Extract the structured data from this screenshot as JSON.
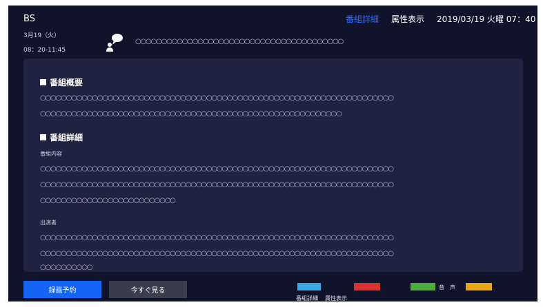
{
  "header": {
    "channel": "BS",
    "tab_detail": "番組詳細",
    "tab_attribute": "属性表示",
    "datetime": "2019/03/19 火曜 07：40"
  },
  "program": {
    "date": "3月19（火）",
    "time": "08：20-11:45",
    "title": "○○○○○○○○○○○○○○○○○○○○○○○○○○○○○○○○○○○○○○○○"
  },
  "content": {
    "summary": {
      "heading": "番組概要",
      "lines": [
        "○○○○○○○○○○○○○○○○○○○○○○○○○○○○○○○○○○○○○○○○○○○○○○○○○○○○○○○○○○○○○○○○○○○○",
        "○○○○○○○○○○○○○○○○○○○○○○○○○○○○○○○○○○○○○○○○○○○○○○○○○○○○○○○○○○"
      ]
    },
    "details": {
      "heading": "番組詳細",
      "content_label": "番組内容",
      "content_lines": [
        "○○○○○○○○○○○○○○○○○○○○○○○○○○○○○○○○○○○○○○○○○○○○○○○○○○○○○○○○○○○○○○○○○○○○",
        "○○○○○○○○○○○○○○○○○○○○○○○○○○○○○○○○○○○○○○○○○○○○○○○○○○○○○○○○○○○○○○○○○○○○",
        "○○○○○○○○○○○○○○○○○○○○○○○○○○"
      ],
      "cast_label": "出演者",
      "cast_lines": [
        "○○○○○○○○○○○○○○○○○○○○○○○○○○○○○○○○○○○○○○○○○○○○○○○○○○○○○○○○○○○○○○○○○○○○",
        "○○○○○○○○○○○○○○○○○○○○○○○○○○○○○○○○○○○○○○○○○○○○○○○○○○○○○○○○○○○○○○○○○○○○",
        "○○○○○○○○○○"
      ]
    }
  },
  "footer": {
    "record_button": "録画予約",
    "watch_button": "今すぐ見る",
    "blue_key_label": "番組詳細",
    "red_key_label": "属性表示",
    "green_key_label": "音　声",
    "key_colors": {
      "blue": "#3aa7e6",
      "red": "#d8322f",
      "green": "#4caf3d",
      "yellow": "#e6a417"
    }
  },
  "colors": {
    "background": "#10132a",
    "panel": "#1f2342",
    "accent": "#1565f5",
    "active_tab": "#2f6cff"
  }
}
